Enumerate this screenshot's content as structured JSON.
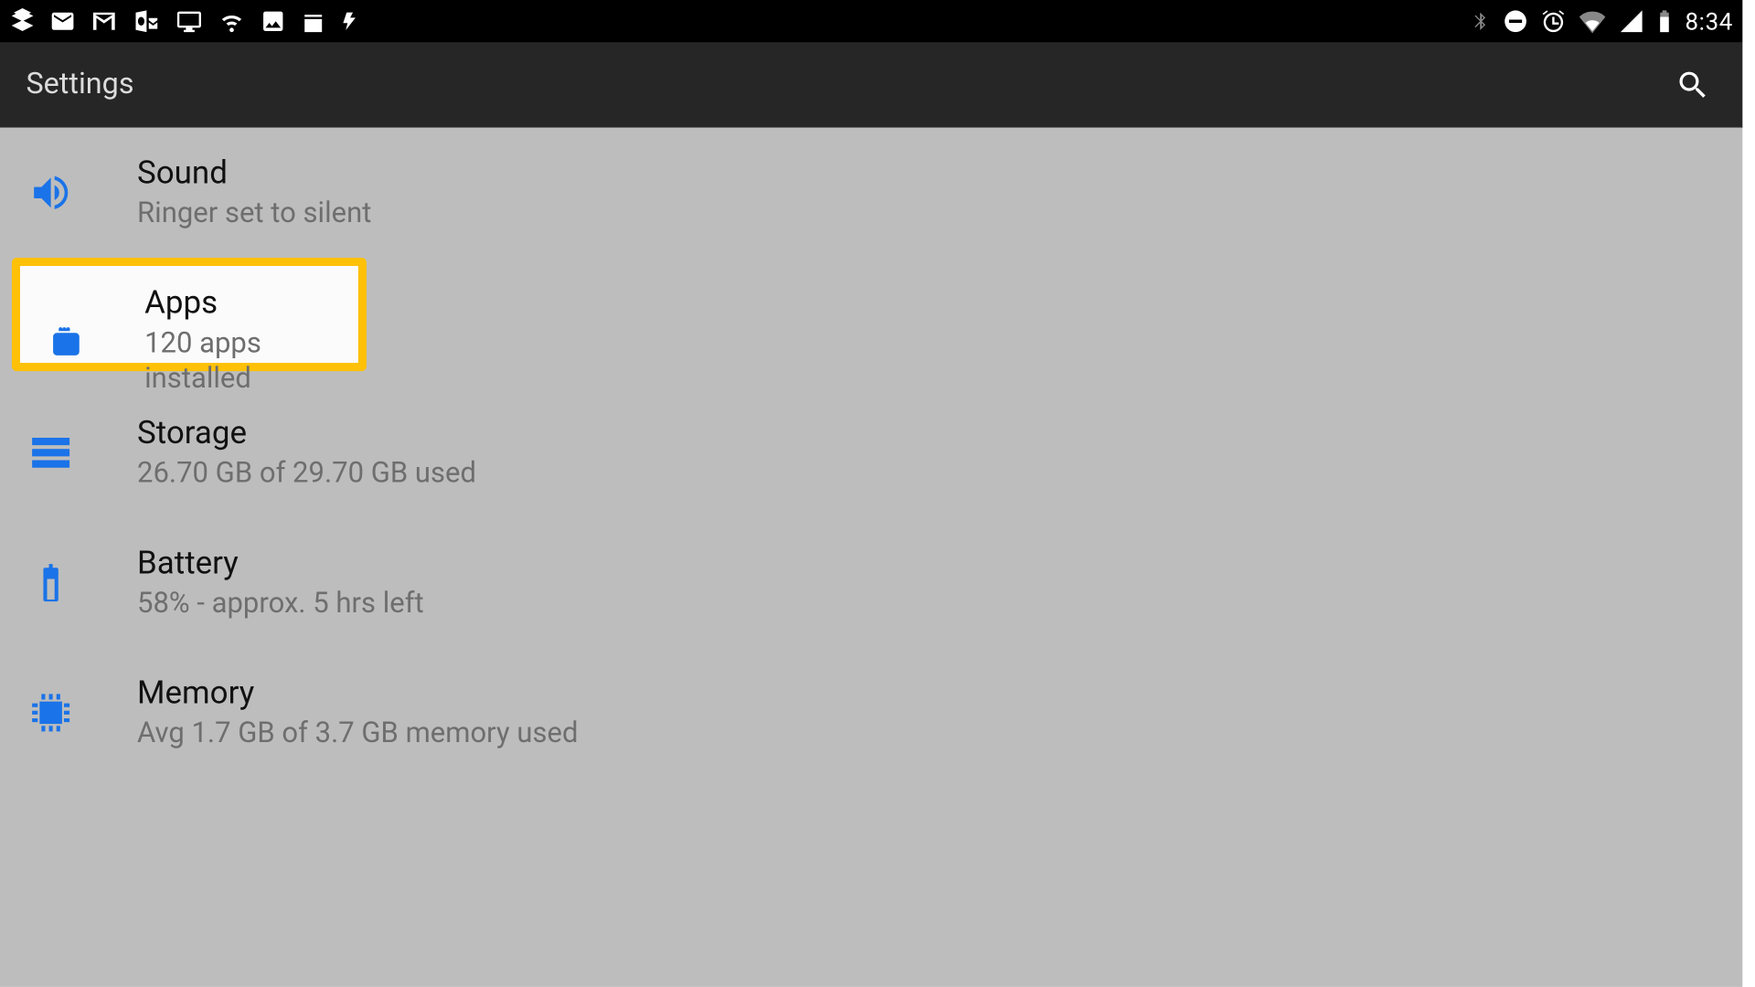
{
  "status_bar": {
    "time": "8:34"
  },
  "app_bar": {
    "title": "Settings"
  },
  "items": [
    {
      "title": "Sound",
      "subtitle": "Ringer set to silent"
    },
    {
      "title": "Apps",
      "subtitle": "120 apps installed"
    },
    {
      "title": "Storage",
      "subtitle": "26.70 GB of 29.70 GB used"
    },
    {
      "title": "Battery",
      "subtitle": "58% - approx. 5 hrs left"
    },
    {
      "title": "Memory",
      "subtitle": "Avg 1.7 GB of 3.7 GB memory used"
    }
  ]
}
